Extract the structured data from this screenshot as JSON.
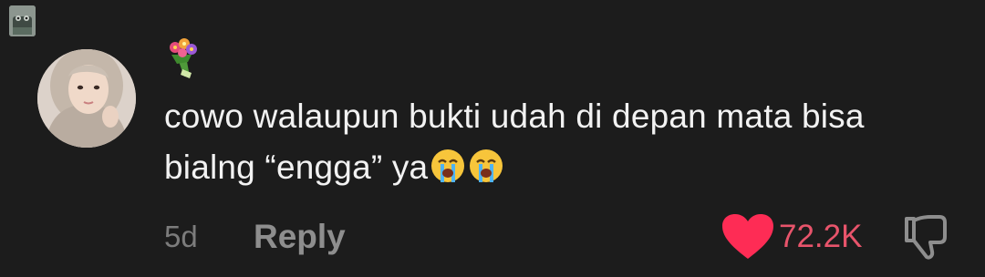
{
  "comment": {
    "username_emoji": "bouquet-icon",
    "text_line1": "cowo walaupun bukti udah di depan mata bisa",
    "text_line2": "bialng “engga” ya",
    "trailing_emojis": [
      "loudly-crying-face-icon",
      "loudly-crying-face-icon"
    ],
    "timestamp": "5d",
    "reply_label": "Reply",
    "like_count": "72.2K",
    "liked": true
  },
  "colors": {
    "background": "#1c1c1c",
    "text": "#f2f2f2",
    "muted": "#7c7c7c",
    "like_accent": "#fe2c55",
    "like_count": "#e8546b"
  }
}
